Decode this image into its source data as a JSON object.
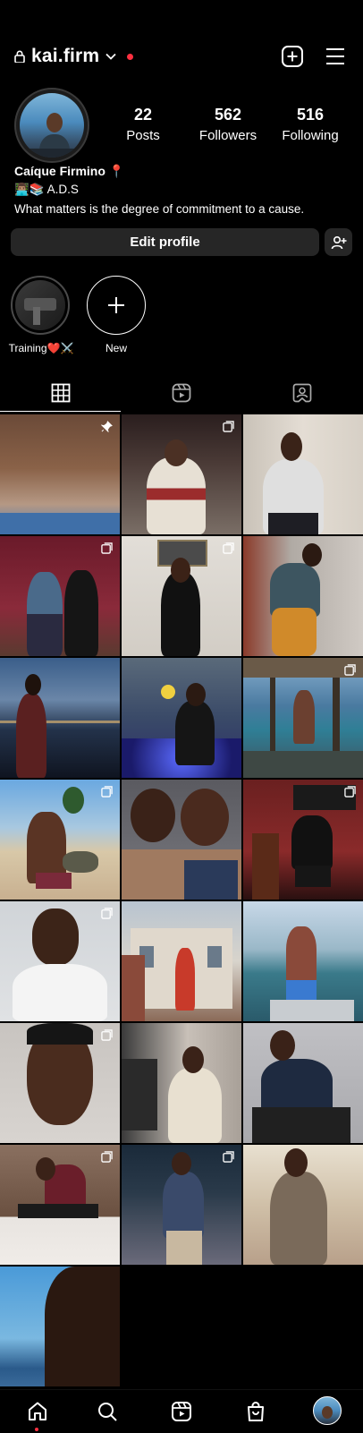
{
  "header": {
    "username": "kai.firm"
  },
  "profile": {
    "stats": [
      {
        "value": "22",
        "label": "Posts"
      },
      {
        "value": "562",
        "label": "Followers"
      },
      {
        "value": "516",
        "label": "Following"
      }
    ],
    "name": "Caíque Firmino 📍",
    "bio_line1": "👨🏽‍💻📚 A.D.S",
    "bio_line2": "What matters is the degree of commitment to a cause.",
    "edit_label": "Edit profile"
  },
  "highlights": [
    {
      "label": "Training❤️⚔️"
    },
    {
      "label": "New"
    }
  ],
  "tabs": [
    {
      "icon": "grid-icon",
      "active": true
    },
    {
      "icon": "reels-icon",
      "active": false
    },
    {
      "icon": "tagged-icon",
      "active": false
    }
  ],
  "posts": [
    {
      "type": "pinned"
    },
    {
      "type": "carousel"
    },
    {
      "type": "single"
    },
    {
      "type": "carousel"
    },
    {
      "type": "carousel"
    },
    {
      "type": "single"
    },
    {
      "type": "single"
    },
    {
      "type": "single"
    },
    {
      "type": "carousel"
    },
    {
      "type": "carousel"
    },
    {
      "type": "single"
    },
    {
      "type": "carousel"
    },
    {
      "type": "carousel"
    },
    {
      "type": "single"
    },
    {
      "type": "single"
    },
    {
      "type": "carousel"
    },
    {
      "type": "single"
    },
    {
      "type": "single"
    },
    {
      "type": "carousel"
    },
    {
      "type": "carousel"
    },
    {
      "type": "single"
    },
    {
      "type": "single"
    }
  ],
  "colors": {
    "background": "#000000",
    "button": "#262626",
    "notification_dot": "#ff3040"
  },
  "bottom_nav": [
    "home-icon",
    "search-icon",
    "reels-icon",
    "shop-icon",
    "profile-avatar"
  ]
}
